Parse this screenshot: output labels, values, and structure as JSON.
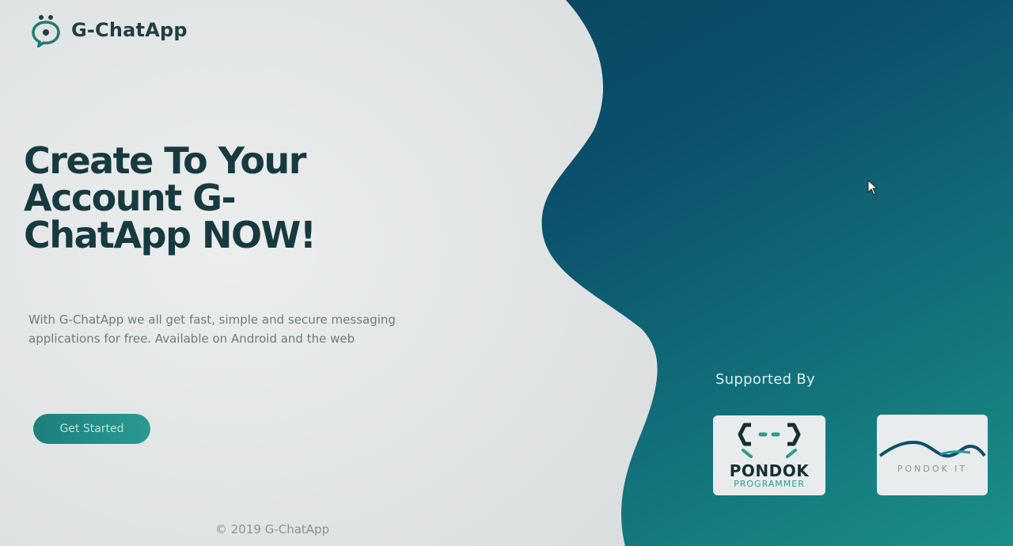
{
  "brand": {
    "name": "G-ChatApp",
    "logo_icon": "chat-bubble-logo-icon"
  },
  "hero": {
    "title": "Create To Your Account G-ChatApp NOW!",
    "description": "With G-ChatApp we all get fast, simple and secure messaging applications for free. Available on Android and the web",
    "cta_label": "Get Started"
  },
  "supported": {
    "title": "Supported By",
    "sponsors": [
      {
        "name": "PONDOK",
        "subtitle": "PROGRAMMER",
        "icon": "curly-braces-icon"
      },
      {
        "name": "PONDOK IT",
        "icon": "wave-icon"
      }
    ]
  },
  "footer": {
    "copyright": "© 2019 G-ChatApp"
  },
  "colors": {
    "accent": "#2a9a92",
    "dark_teal": "#0b4f6c",
    "title_text": "#173a40",
    "panel_bg": "#e6e8e8"
  }
}
